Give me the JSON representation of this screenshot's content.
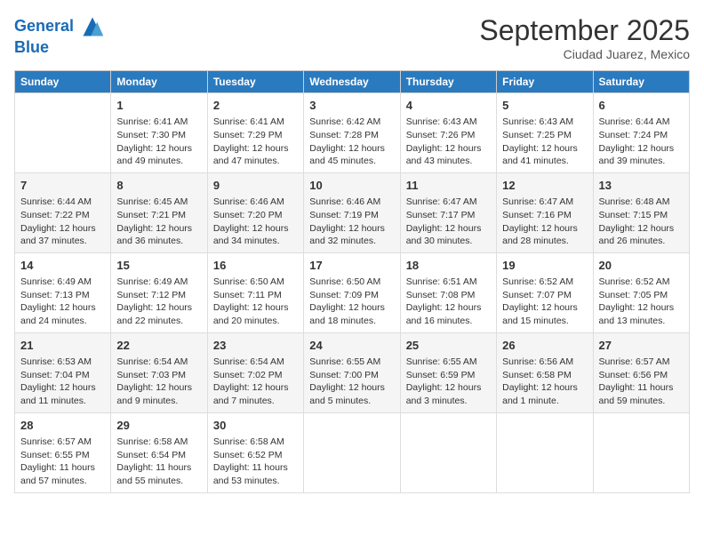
{
  "header": {
    "logo_line1": "General",
    "logo_line2": "Blue",
    "month": "September 2025",
    "location": "Ciudad Juarez, Mexico"
  },
  "days_of_week": [
    "Sunday",
    "Monday",
    "Tuesday",
    "Wednesday",
    "Thursday",
    "Friday",
    "Saturday"
  ],
  "weeks": [
    [
      {
        "day": "",
        "info": ""
      },
      {
        "day": "1",
        "info": "Sunrise: 6:41 AM\nSunset: 7:30 PM\nDaylight: 12 hours\nand 49 minutes."
      },
      {
        "day": "2",
        "info": "Sunrise: 6:41 AM\nSunset: 7:29 PM\nDaylight: 12 hours\nand 47 minutes."
      },
      {
        "day": "3",
        "info": "Sunrise: 6:42 AM\nSunset: 7:28 PM\nDaylight: 12 hours\nand 45 minutes."
      },
      {
        "day": "4",
        "info": "Sunrise: 6:43 AM\nSunset: 7:26 PM\nDaylight: 12 hours\nand 43 minutes."
      },
      {
        "day": "5",
        "info": "Sunrise: 6:43 AM\nSunset: 7:25 PM\nDaylight: 12 hours\nand 41 minutes."
      },
      {
        "day": "6",
        "info": "Sunrise: 6:44 AM\nSunset: 7:24 PM\nDaylight: 12 hours\nand 39 minutes."
      }
    ],
    [
      {
        "day": "7",
        "info": "Sunrise: 6:44 AM\nSunset: 7:22 PM\nDaylight: 12 hours\nand 37 minutes."
      },
      {
        "day": "8",
        "info": "Sunrise: 6:45 AM\nSunset: 7:21 PM\nDaylight: 12 hours\nand 36 minutes."
      },
      {
        "day": "9",
        "info": "Sunrise: 6:46 AM\nSunset: 7:20 PM\nDaylight: 12 hours\nand 34 minutes."
      },
      {
        "day": "10",
        "info": "Sunrise: 6:46 AM\nSunset: 7:19 PM\nDaylight: 12 hours\nand 32 minutes."
      },
      {
        "day": "11",
        "info": "Sunrise: 6:47 AM\nSunset: 7:17 PM\nDaylight: 12 hours\nand 30 minutes."
      },
      {
        "day": "12",
        "info": "Sunrise: 6:47 AM\nSunset: 7:16 PM\nDaylight: 12 hours\nand 28 minutes."
      },
      {
        "day": "13",
        "info": "Sunrise: 6:48 AM\nSunset: 7:15 PM\nDaylight: 12 hours\nand 26 minutes."
      }
    ],
    [
      {
        "day": "14",
        "info": "Sunrise: 6:49 AM\nSunset: 7:13 PM\nDaylight: 12 hours\nand 24 minutes."
      },
      {
        "day": "15",
        "info": "Sunrise: 6:49 AM\nSunset: 7:12 PM\nDaylight: 12 hours\nand 22 minutes."
      },
      {
        "day": "16",
        "info": "Sunrise: 6:50 AM\nSunset: 7:11 PM\nDaylight: 12 hours\nand 20 minutes."
      },
      {
        "day": "17",
        "info": "Sunrise: 6:50 AM\nSunset: 7:09 PM\nDaylight: 12 hours\nand 18 minutes."
      },
      {
        "day": "18",
        "info": "Sunrise: 6:51 AM\nSunset: 7:08 PM\nDaylight: 12 hours\nand 16 minutes."
      },
      {
        "day": "19",
        "info": "Sunrise: 6:52 AM\nSunset: 7:07 PM\nDaylight: 12 hours\nand 15 minutes."
      },
      {
        "day": "20",
        "info": "Sunrise: 6:52 AM\nSunset: 7:05 PM\nDaylight: 12 hours\nand 13 minutes."
      }
    ],
    [
      {
        "day": "21",
        "info": "Sunrise: 6:53 AM\nSunset: 7:04 PM\nDaylight: 12 hours\nand 11 minutes."
      },
      {
        "day": "22",
        "info": "Sunrise: 6:54 AM\nSunset: 7:03 PM\nDaylight: 12 hours\nand 9 minutes."
      },
      {
        "day": "23",
        "info": "Sunrise: 6:54 AM\nSunset: 7:02 PM\nDaylight: 12 hours\nand 7 minutes."
      },
      {
        "day": "24",
        "info": "Sunrise: 6:55 AM\nSunset: 7:00 PM\nDaylight: 12 hours\nand 5 minutes."
      },
      {
        "day": "25",
        "info": "Sunrise: 6:55 AM\nSunset: 6:59 PM\nDaylight: 12 hours\nand 3 minutes."
      },
      {
        "day": "26",
        "info": "Sunrise: 6:56 AM\nSunset: 6:58 PM\nDaylight: 12 hours\nand 1 minute."
      },
      {
        "day": "27",
        "info": "Sunrise: 6:57 AM\nSunset: 6:56 PM\nDaylight: 11 hours\nand 59 minutes."
      }
    ],
    [
      {
        "day": "28",
        "info": "Sunrise: 6:57 AM\nSunset: 6:55 PM\nDaylight: 11 hours\nand 57 minutes."
      },
      {
        "day": "29",
        "info": "Sunrise: 6:58 AM\nSunset: 6:54 PM\nDaylight: 11 hours\nand 55 minutes."
      },
      {
        "day": "30",
        "info": "Sunrise: 6:58 AM\nSunset: 6:52 PM\nDaylight: 11 hours\nand 53 minutes."
      },
      {
        "day": "",
        "info": ""
      },
      {
        "day": "",
        "info": ""
      },
      {
        "day": "",
        "info": ""
      },
      {
        "day": "",
        "info": ""
      }
    ]
  ]
}
